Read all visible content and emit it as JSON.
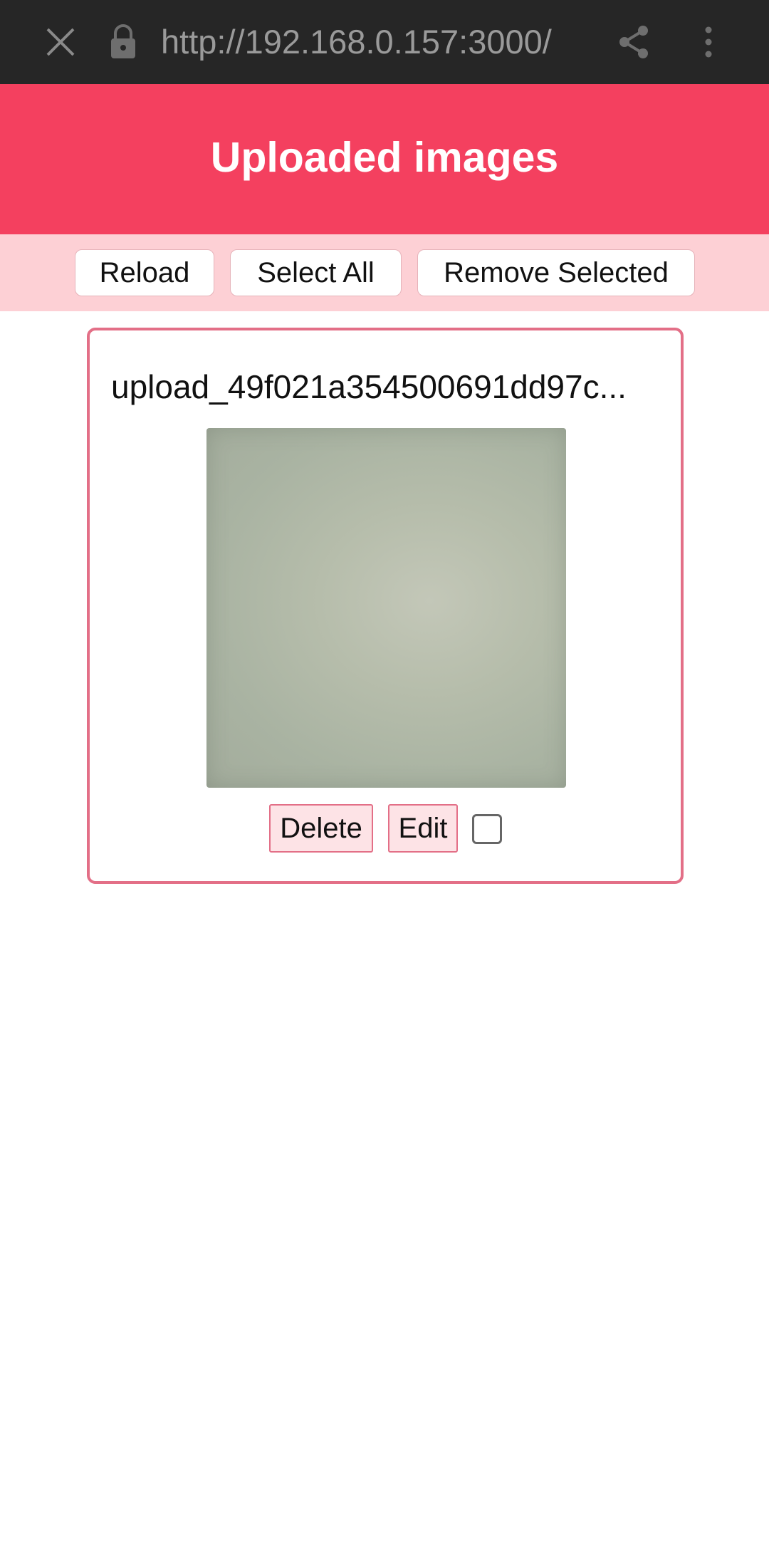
{
  "browser": {
    "url": "http://192.168.0.157:3000/",
    "icons": [
      "close-icon",
      "lock-icon",
      "share-icon",
      "more-vert-icon"
    ]
  },
  "header": {
    "title": "Uploaded images",
    "color": "#f4405f"
  },
  "toolbar": {
    "reload_label": "Reload",
    "select_all_label": "Select All",
    "remove_selected_label": "Remove Selected",
    "background": "#fdd0d5"
  },
  "images": [
    {
      "filename": "upload_49f021a354500691dd97c...",
      "delete_label": "Delete",
      "edit_label": "Edit",
      "selected": false
    }
  ],
  "colors": {
    "accent": "#f4405f",
    "card_border": "#e36f87",
    "button_bg": "#fde3e6"
  }
}
